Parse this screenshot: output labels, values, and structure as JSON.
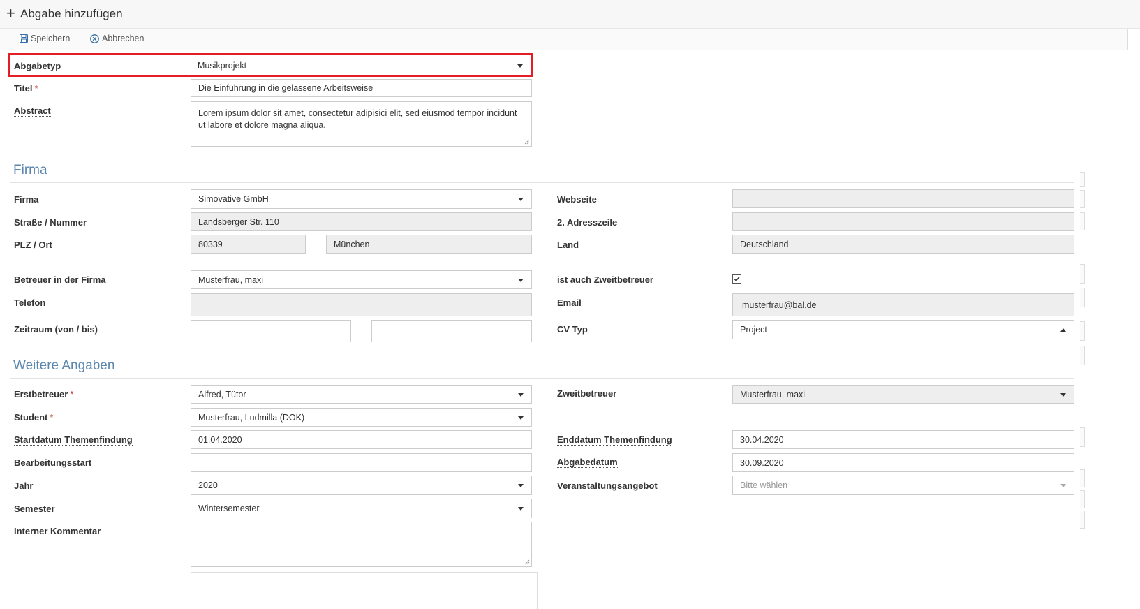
{
  "header": {
    "title": "Abgabe hinzufügen",
    "add_icon": "plus-icon"
  },
  "toolbar": {
    "save_label": "Speichern",
    "save_icon": "floppy-disk-icon",
    "cancel_label": "Abbrechen",
    "cancel_icon": "circle-x-icon"
  },
  "form": {
    "abgabetyp": {
      "label": "Abgabetyp",
      "value": "Musikprojekt"
    },
    "titel": {
      "label": "Titel",
      "required": "*",
      "value": "Die Einführung in die gelassene Arbeitsweise"
    },
    "abstract": {
      "label": "Abstract",
      "value": "Lorem ipsum dolor sit amet, consectetur adipisici elit, sed eiusmod tempor incidunt ut labore et dolore magna aliqua."
    }
  },
  "firma": {
    "section_title": "Firma",
    "firma": {
      "label": "Firma",
      "value": "Simovative GmbH"
    },
    "strasse": {
      "label": "Straße / Nummer",
      "value": "Landsberger Str. 110"
    },
    "plz_ort": {
      "label": "PLZ / Ort",
      "plz": "80339",
      "ort": "München"
    },
    "webseite": {
      "label": "Webseite",
      "value": ""
    },
    "adresszeile2": {
      "label": "2. Adresszeile",
      "value": ""
    },
    "land": {
      "label": "Land",
      "value": "Deutschland"
    },
    "betreuer": {
      "label": "Betreuer in der Firma",
      "value": "Musterfrau, maxi"
    },
    "zweitbetreuer_flag": {
      "label": "ist auch Zweitbetreuer",
      "checked": true
    },
    "telefon": {
      "label": "Telefon",
      "value": ""
    },
    "email": {
      "label": "Email",
      "value": "musterfrau@bal.de"
    },
    "zeitraum": {
      "label": "Zeitraum (von / bis)",
      "von": "",
      "bis": ""
    },
    "cv_typ": {
      "label": "CV Typ",
      "value": "Project"
    }
  },
  "weitere": {
    "section_title": "Weitere Angaben",
    "erstbetreuer": {
      "label": "Erstbetreuer",
      "required": "*",
      "value": "Alfred, Tütor"
    },
    "zweitbetreuer": {
      "label": "Zweitbetreuer",
      "value": "Musterfrau, maxi"
    },
    "student": {
      "label": "Student",
      "required": "*",
      "value": "Musterfrau, Ludmilla (DOK)"
    },
    "startdatum": {
      "label": "Startdatum Themenfindung",
      "value": "01.04.2020"
    },
    "enddatum": {
      "label": "Enddatum Themenfindung",
      "value": "30.04.2020"
    },
    "bearbeitungsstart": {
      "label": "Bearbeitungsstart",
      "value": ""
    },
    "abgabedatum": {
      "label": "Abgabedatum",
      "value": "30.09.2020"
    },
    "jahr": {
      "label": "Jahr",
      "value": "2020"
    },
    "veranstaltungsangebot": {
      "label": "Veranstaltungsangebot",
      "placeholder": "Bitte wählen"
    },
    "semester": {
      "label": "Semester",
      "value": "Wintersemester"
    },
    "kommentar": {
      "label": "Interner Kommentar",
      "value": ""
    }
  },
  "colors": {
    "highlight": "#e41e26",
    "section": "#5b86ad",
    "readonly_bg": "#eeeeee",
    "required": "#c0392b"
  }
}
